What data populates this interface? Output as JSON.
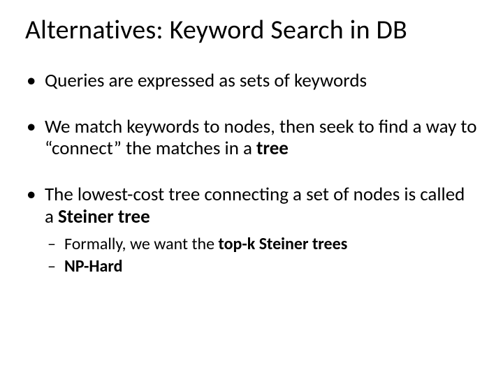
{
  "title": "Alternatives: Keyword Search in DB",
  "bullets": {
    "b1": "Queries are expressed as sets of keywords",
    "b2_a": "We match keywords to nodes, then seek to find a way to “connect” the matches in a ",
    "b2_b": "tree",
    "b3_a": "The lowest-cost tree connecting a set of nodes is called a ",
    "b3_b": "Steiner tree",
    "s1_a": "Formally, we want the ",
    "s1_b": "top-k Steiner trees",
    "s2": "NP-Hard"
  }
}
